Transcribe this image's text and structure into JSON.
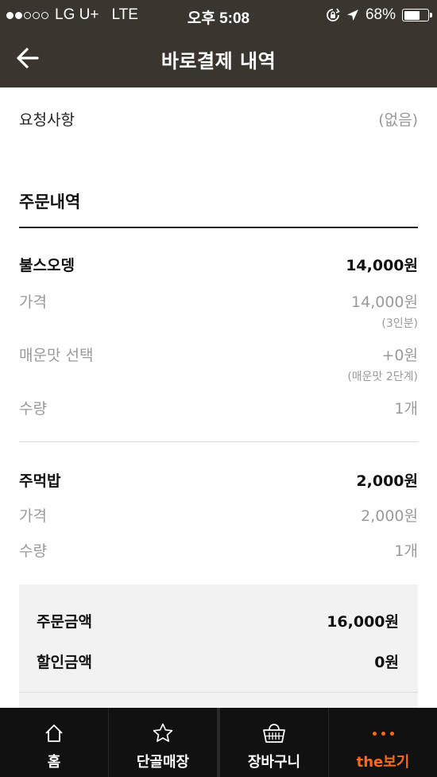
{
  "status_bar": {
    "carrier": "LG U+",
    "network": "LTE",
    "time": "오후 5:08",
    "battery": "68%",
    "battery_level": 0.68
  },
  "header": {
    "title": "바로결제 내역"
  },
  "request": {
    "label": "요청사항",
    "value": "(없음)"
  },
  "order": {
    "title": "주문내역",
    "items": [
      {
        "name": "불스오뎅",
        "total": "14,000원",
        "price_label": "가격",
        "price": "14,000원",
        "price_note": "(3인분)",
        "option_label": "매운맛 선택",
        "option_value": "+0원",
        "option_note": "(매운맛 2단계)",
        "qty_label": "수량",
        "qty": "1개"
      },
      {
        "name": "주먹밥",
        "total": "2,000원",
        "price_label": "가격",
        "price": "2,000원",
        "qty_label": "수량",
        "qty": "1개"
      }
    ]
  },
  "summary": {
    "order_amount_label": "주문금액",
    "order_amount": "16,000원",
    "discount_label": "할인금액",
    "discount": "0원"
  },
  "tabs": [
    {
      "label": "홈",
      "icon": "home-icon"
    },
    {
      "label": "단골매장",
      "icon": "star-icon"
    },
    {
      "label": "장바구니",
      "icon": "basket-icon"
    },
    {
      "label": "the보기",
      "icon": "more-dots-icon"
    }
  ],
  "colors": {
    "header_bg": "#3b3530",
    "tab_bg": "#111111",
    "accent": "#ff6a1a"
  }
}
